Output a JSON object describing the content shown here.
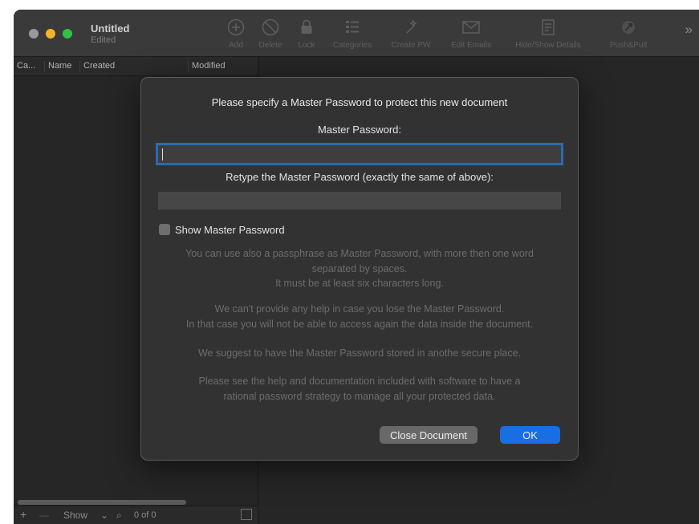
{
  "window": {
    "title": "Untitled",
    "subtitle": "Edited"
  },
  "toolbar": {
    "items": [
      {
        "label": "Add",
        "icon": "add-icon"
      },
      {
        "label": "Delete",
        "icon": "delete-icon"
      },
      {
        "label": "Lock",
        "icon": "lock-icon"
      },
      {
        "label": "Categories",
        "icon": "categories-icon"
      },
      {
        "label": "Create PW",
        "icon": "create-pw-icon"
      },
      {
        "label": "Edit Emails",
        "icon": "email-icon"
      },
      {
        "label": "Hide/Show Details",
        "icon": "details-panel-icon"
      },
      {
        "label": "Push&Pull",
        "icon": "push-pull-icon"
      }
    ],
    "overflow": "»"
  },
  "table": {
    "columns": [
      "Ca...",
      "Name",
      "Created",
      "Modified"
    ]
  },
  "bottom_bar": {
    "add": "+",
    "remove": "—",
    "show_label": "Show",
    "show_chevron": "⌄",
    "search_icon": "⌕",
    "count": "0 of 0"
  },
  "dialog": {
    "heading": "Please specify a Master Password to protect this new document",
    "password_label": "Master Password:",
    "password_value": "",
    "retype_label": "Retype the Master Password (exactly the same of above):",
    "retype_value": "",
    "show_password_label": "Show Master Password",
    "show_password_checked": false,
    "info": [
      [
        "You can use also a passphrase as Master Password, with more then one word",
        "separated by spaces.",
        "It must be at least six characters long."
      ],
      [
        "We can't provide any help in case you lose the Master Password.",
        "In that case you will not be able to access again the data inside the document."
      ],
      [
        "We suggest to have the Master Password stored in anothe secure place."
      ],
      [
        "Please see the help and documentation included with software to have a",
        "rational password strategy to manage all your protected data."
      ]
    ],
    "close_button": "Close Document",
    "ok_button": "OK"
  },
  "colors": {
    "accent": "#1a6ee3",
    "focus_ring": "#2b6bb0",
    "traffic_close": "#9a9a9a",
    "traffic_minimize": "#f5b52a",
    "traffic_maximize": "#2fc246"
  }
}
